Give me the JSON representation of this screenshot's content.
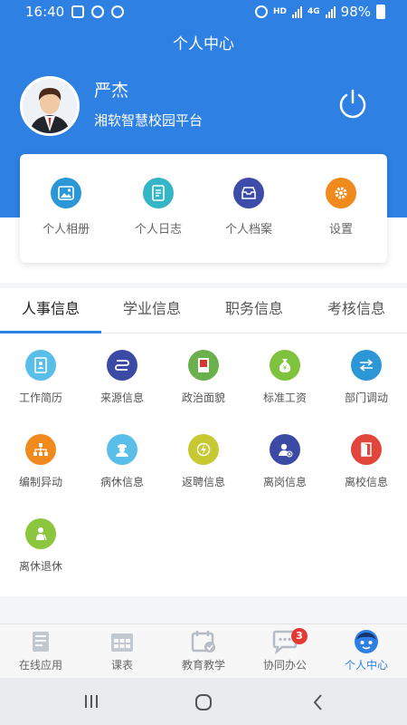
{
  "status_bar": {
    "time": "16:40",
    "network": "HD",
    "net_type": "4G",
    "battery": "98%"
  },
  "nav": {
    "title": "个人中心"
  },
  "profile": {
    "name": "严杰",
    "organization": "湘软智慧校园平台"
  },
  "quick_actions": [
    {
      "label": "个人相册",
      "icon": "image-icon",
      "color": "#2b97d6"
    },
    {
      "label": "个人日志",
      "icon": "notebook-icon",
      "color": "#35b6c5"
    },
    {
      "label": "个人档案",
      "icon": "archive-tray-icon",
      "color": "#3d4ca8"
    },
    {
      "label": "设置",
      "icon": "gear-icon",
      "color": "#f08a1c"
    }
  ],
  "tabs": [
    {
      "label": "人事信息",
      "active": true
    },
    {
      "label": "学业信息",
      "active": false
    },
    {
      "label": "职务信息",
      "active": false
    },
    {
      "label": "考核信息",
      "active": false
    }
  ],
  "grid": [
    {
      "label": "工作简历",
      "icon": "resume-icon",
      "color": "#59bfe8"
    },
    {
      "label": "来源信息",
      "icon": "route-icon",
      "color": "#3b4aa5"
    },
    {
      "label": "政治面貌",
      "icon": "party-book-icon",
      "color": "#6ab04c"
    },
    {
      "label": "标准工资",
      "icon": "money-bag-icon",
      "color": "#7ec23d"
    },
    {
      "label": "部门调动",
      "icon": "transfer-arrows-icon",
      "color": "#2b97d6"
    },
    {
      "label": "编制异动",
      "icon": "org-chart-icon",
      "color": "#f08a1c"
    },
    {
      "label": "病休信息",
      "icon": "nurse-icon",
      "color": "#59bfe8"
    },
    {
      "label": "返聘信息",
      "icon": "rehire-bolt-icon",
      "color": "#c7c832"
    },
    {
      "label": "离岗信息",
      "icon": "user-remove-icon",
      "color": "#3b4aa5"
    },
    {
      "label": "离校信息",
      "icon": "exit-door-icon",
      "color": "#e0463a"
    },
    {
      "label": "离休退休",
      "icon": "retiree-icon",
      "color": "#8cc63f"
    }
  ],
  "bottom_nav": [
    {
      "label": "在线应用",
      "icon": "scroll-icon",
      "active": false
    },
    {
      "label": "课表",
      "icon": "timetable-icon",
      "active": false
    },
    {
      "label": "教育教学",
      "icon": "calendar-check-icon",
      "active": false
    },
    {
      "label": "协同办公",
      "icon": "chat-icon",
      "active": false,
      "badge": "3"
    },
    {
      "label": "个人中心",
      "icon": "profile-face-icon",
      "active": true
    }
  ],
  "colors": {
    "primary": "#2f80e3",
    "badge": "#e53935"
  }
}
